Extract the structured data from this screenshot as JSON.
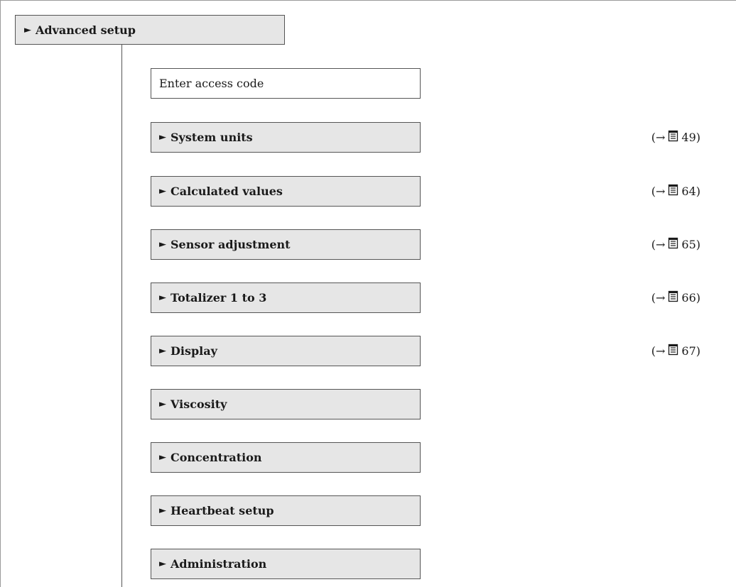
{
  "header": {
    "arrow": "►",
    "title": "Advanced setup"
  },
  "items": [
    {
      "arrow": "",
      "label": "Enter access code",
      "ref_page": ""
    },
    {
      "arrow": "►",
      "label": "System units",
      "ref_page": "49"
    },
    {
      "arrow": "►",
      "label": "Calculated values",
      "ref_page": "64"
    },
    {
      "arrow": "►",
      "label": "Sensor adjustment",
      "ref_page": "65"
    },
    {
      "arrow": "►",
      "label": "Totalizer 1 to 3",
      "ref_page": "66"
    },
    {
      "arrow": "►",
      "label": "Display",
      "ref_page": "67"
    },
    {
      "arrow": "►",
      "label": "Viscosity",
      "ref_page": ""
    },
    {
      "arrow": "►",
      "label": "Concentration",
      "ref_page": ""
    },
    {
      "arrow": "►",
      "label": "Heartbeat setup",
      "ref_page": ""
    },
    {
      "arrow": "►",
      "label": "Administration",
      "ref_page": ""
    }
  ],
  "ref": {
    "open": "(→",
    "close": ")"
  },
  "icons": {
    "submenu_arrow": "right-triangle-icon",
    "page_reference": "book-page-icon"
  }
}
